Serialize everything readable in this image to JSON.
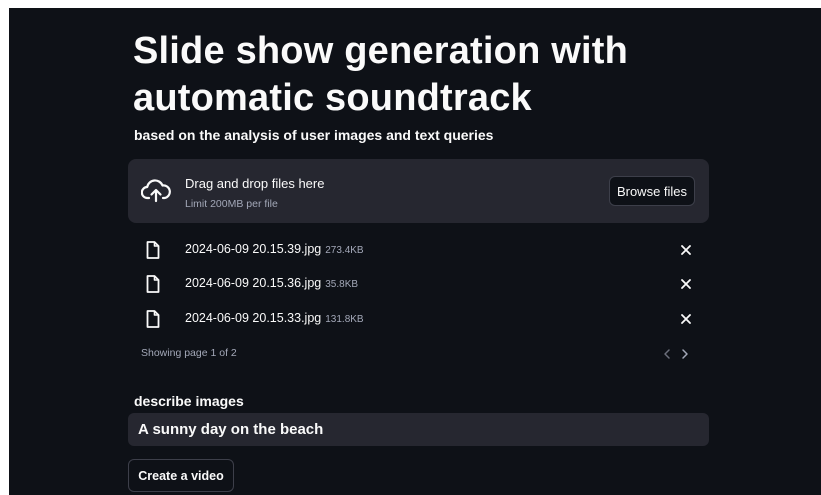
{
  "header": {
    "title": "Slide show generation with automatic soundtrack",
    "subtitle": "based on the analysis of user images and text queries"
  },
  "uploader": {
    "icon": "cloud-upload-icon",
    "drag_text": "Drag and drop files here",
    "limit_text": "Limit 200MB per file",
    "browse_label": "Browse files"
  },
  "files": [
    {
      "name": "2024-06-09 20.15.39.jpg",
      "size": "273.4KB"
    },
    {
      "name": "2024-06-09 20.15.36.jpg",
      "size": "35.8KB"
    },
    {
      "name": "2024-06-09 20.15.33.jpg",
      "size": "131.8KB"
    }
  ],
  "pagination": {
    "text": "Showing page 1 of 2"
  },
  "description": {
    "label": "describe images",
    "value": "A sunny day on the beach"
  },
  "actions": {
    "create_label": "Create a video"
  },
  "colors": {
    "background": "#0e1117",
    "panel": "#262730",
    "text": "#fafafa",
    "muted_text": "#a3a8b8",
    "border": "#3d3f4a"
  }
}
